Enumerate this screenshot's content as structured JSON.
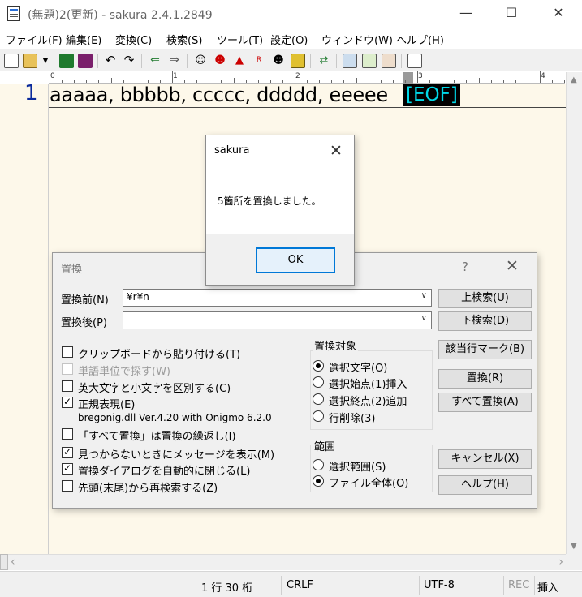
{
  "window": {
    "title": "(無題)2(更新) - sakura 2.4.1.2849",
    "minimize": "—",
    "maximize": "☐",
    "close": "✕"
  },
  "menu": [
    "ファイル(F)",
    "編集(E)",
    "変換(C)",
    "検索(S)",
    "ツール(T)",
    "設定(O)",
    "ウィンドウ(W)",
    "ヘルプ(H)"
  ],
  "toolbar_icons": [
    "new-file-icon",
    "open-folder-icon",
    "dropdown-icon",
    "save-icon",
    "save-all-icon",
    "undo-icon",
    "redo-icon",
    "jump-back-icon",
    "jump-forward-icon",
    "search-icon",
    "search-prev-icon",
    "search-next-icon",
    "regex-search-icon",
    "grep-icon",
    "tag-jump-icon",
    "outline-icon",
    "print-icon",
    "print-preview-icon",
    "settings-icon",
    "font-icon"
  ],
  "ruler": {
    "labels": [
      "0",
      "1",
      "2",
      "3",
      "4"
    ]
  },
  "editor": {
    "line_number": "1",
    "text": "aaaaa, bbbbb, ccccc, ddddd, eeeee",
    "eof": "[EOF]"
  },
  "statusbar": {
    "position": "1 行  30 桁",
    "line_ending": "CRLF",
    "encoding": "UTF-8",
    "rec": "REC",
    "mode": "挿入"
  },
  "replace_dialog": {
    "title": "置換",
    "help": "?",
    "close": "✕",
    "before_label": "置換前(N)",
    "before_value": "¥r¥n",
    "after_label": "置換後(P)",
    "after_value": "",
    "options": [
      {
        "label": "クリップボードから貼り付ける(T)",
        "checked": false,
        "enabled": true
      },
      {
        "label": "単語単位で探す(W)",
        "checked": false,
        "enabled": false
      },
      {
        "label": "英大文字と小文字を区別する(C)",
        "checked": false,
        "enabled": true
      },
      {
        "label": "正規表現(E)",
        "checked": true,
        "enabled": true
      }
    ],
    "regex_info": "bregonig.dll Ver.4.20 with Onigmo 6.2.0",
    "options2": [
      {
        "label": "「すべて置換」は置換の繰返し(I)",
        "checked": false
      },
      {
        "label": "見つからないときにメッセージを表示(M)",
        "checked": true
      },
      {
        "label": "置換ダイアログを自動的に閉じる(L)",
        "checked": true
      },
      {
        "label": "先頭(末尾)から再検索する(Z)",
        "checked": false
      }
    ],
    "target_group": {
      "title": "置換対象",
      "items": [
        {
          "label": "選択文字(O)",
          "selected": true
        },
        {
          "label": "選択始点(1)挿入",
          "selected": false
        },
        {
          "label": "選択終点(2)追加",
          "selected": false
        },
        {
          "label": "行削除(3)",
          "selected": false
        }
      ]
    },
    "range_group": {
      "title": "範囲",
      "items": [
        {
          "label": "選択範囲(S)",
          "selected": false
        },
        {
          "label": "ファイル全体(O)",
          "selected": true
        }
      ]
    },
    "buttons": {
      "search_up": "上検索(U)",
      "search_down": "下検索(D)",
      "mark": "該当行マーク(B)",
      "replace": "置換(R)",
      "replace_all": "すべて置換(A)",
      "cancel": "キャンセル(X)",
      "help": "ヘルプ(H)"
    }
  },
  "message_box": {
    "title": "sakura",
    "close": "✕",
    "text": "5箇所を置換しました。",
    "ok": "OK"
  },
  "colors": {
    "editor_bg": "#fdf8ea",
    "line_number": "#0a2a9c",
    "eof_fg": "#00d8e8",
    "eof_bg": "#000000",
    "default_button_border": "#0078d7"
  }
}
